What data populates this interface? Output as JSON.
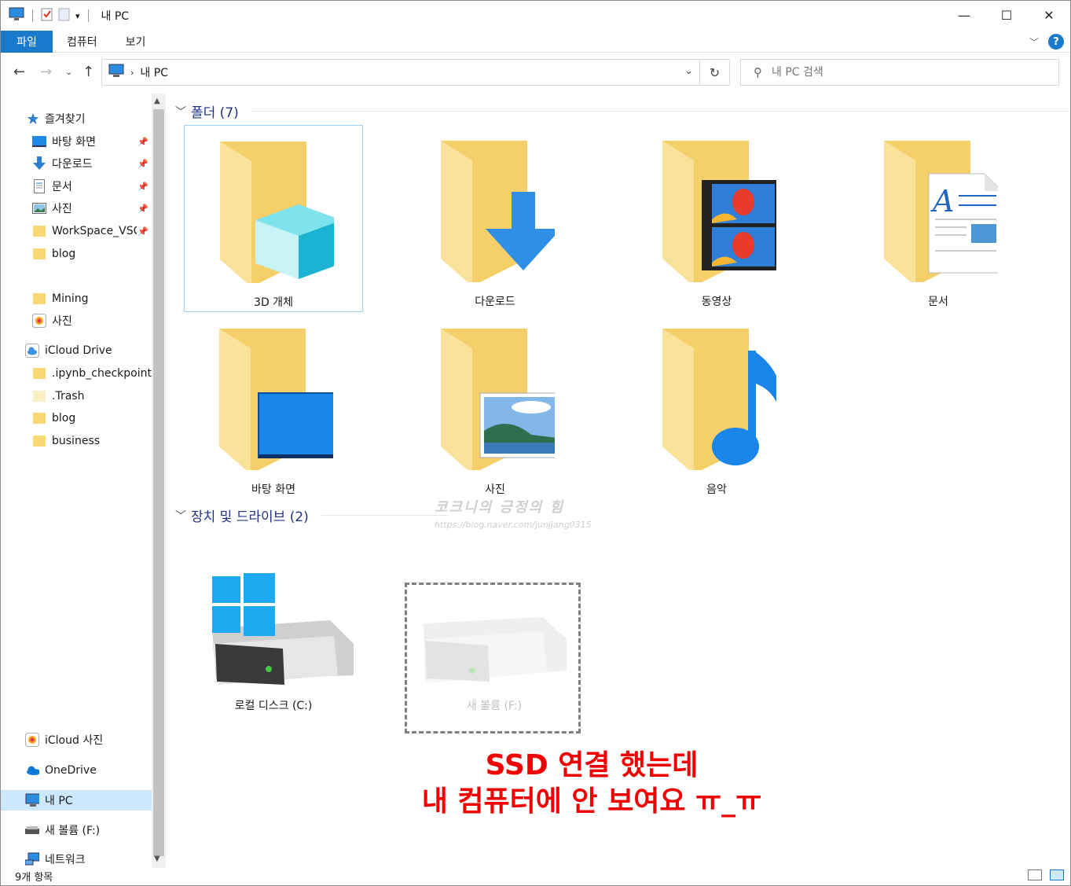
{
  "window": {
    "title": "내 PC",
    "controls": {
      "minimize": "—",
      "maximize": "☐",
      "close": "✕"
    }
  },
  "ribbon": {
    "tabs": [
      {
        "label": "파일"
      },
      {
        "label": "컴퓨터"
      },
      {
        "label": "보기"
      }
    ],
    "help": "?"
  },
  "address": {
    "path": [
      "내 PC"
    ],
    "search_placeholder": "내 PC 검색"
  },
  "sidebar": {
    "items": [
      {
        "label": "즐겨찾기",
        "icon": "star-icon"
      },
      {
        "label": "바탕 화면",
        "icon": "desktop-icon",
        "pinned": true
      },
      {
        "label": "다운로드",
        "icon": "download-icon",
        "pinned": true
      },
      {
        "label": "문서",
        "icon": "document-icon",
        "pinned": true
      },
      {
        "label": "사진",
        "icon": "pictures-icon",
        "pinned": true
      },
      {
        "label": "WorkSpace_VSC",
        "icon": "folder-icon",
        "pinned": true
      },
      {
        "label": "blog",
        "icon": "folder-icon"
      },
      {
        "label": "Mining",
        "icon": "folder-icon"
      },
      {
        "label": "사진",
        "icon": "photos-app-icon"
      },
      {
        "label": "iCloud Drive",
        "icon": "icloud-icon"
      },
      {
        "label": ".ipynb_checkpoints",
        "icon": "folder-icon"
      },
      {
        "label": ".Trash",
        "icon": "folder-icon"
      },
      {
        "label": "blog",
        "icon": "folder-icon"
      },
      {
        "label": "business",
        "icon": "folder-icon"
      },
      {
        "label": "iCloud 사진",
        "icon": "photos-app-icon"
      },
      {
        "label": "OneDrive",
        "icon": "onedrive-icon"
      },
      {
        "label": "내 PC",
        "icon": "computer-icon",
        "selected": true
      },
      {
        "label": "새 볼륨 (F:)",
        "icon": "drive-icon"
      },
      {
        "label": "네트워크",
        "icon": "network-icon"
      }
    ]
  },
  "content": {
    "folders_header": "폴더 (7)",
    "folders": [
      {
        "label": "3D 개체",
        "icon": "3d-objects-folder-icon"
      },
      {
        "label": "다운로드",
        "icon": "downloads-folder-icon"
      },
      {
        "label": "동영상",
        "icon": "videos-folder-icon"
      },
      {
        "label": "문서",
        "icon": "documents-folder-icon"
      },
      {
        "label": "바탕 화면",
        "icon": "desktop-folder-icon"
      },
      {
        "label": "사진",
        "icon": "pictures-folder-icon"
      },
      {
        "label": "음악",
        "icon": "music-folder-icon"
      }
    ],
    "devices_header": "장치 및 드라이브 (2)",
    "devices": [
      {
        "label": "로컬 디스크 (C:)",
        "icon": "windows-drive-icon"
      },
      {
        "label": "새 볼륨 (F:)",
        "icon": "drive-icon",
        "disabled": true
      }
    ],
    "annotation": {
      "line1": "SSD 연결 했는데",
      "line2": "내 컴퓨터에 안 보여요 ㅠ_ㅠ",
      "color": "#f00000"
    },
    "watermark": {
      "line1": "코크니의 긍정의 힘",
      "line2": "https://blog.naver.com/junjjang0315"
    }
  },
  "status": {
    "count": "9개 항목"
  },
  "colors": {
    "accent": "#1979ca",
    "selection": "#cce8ff",
    "group_header": "#1e3287"
  }
}
